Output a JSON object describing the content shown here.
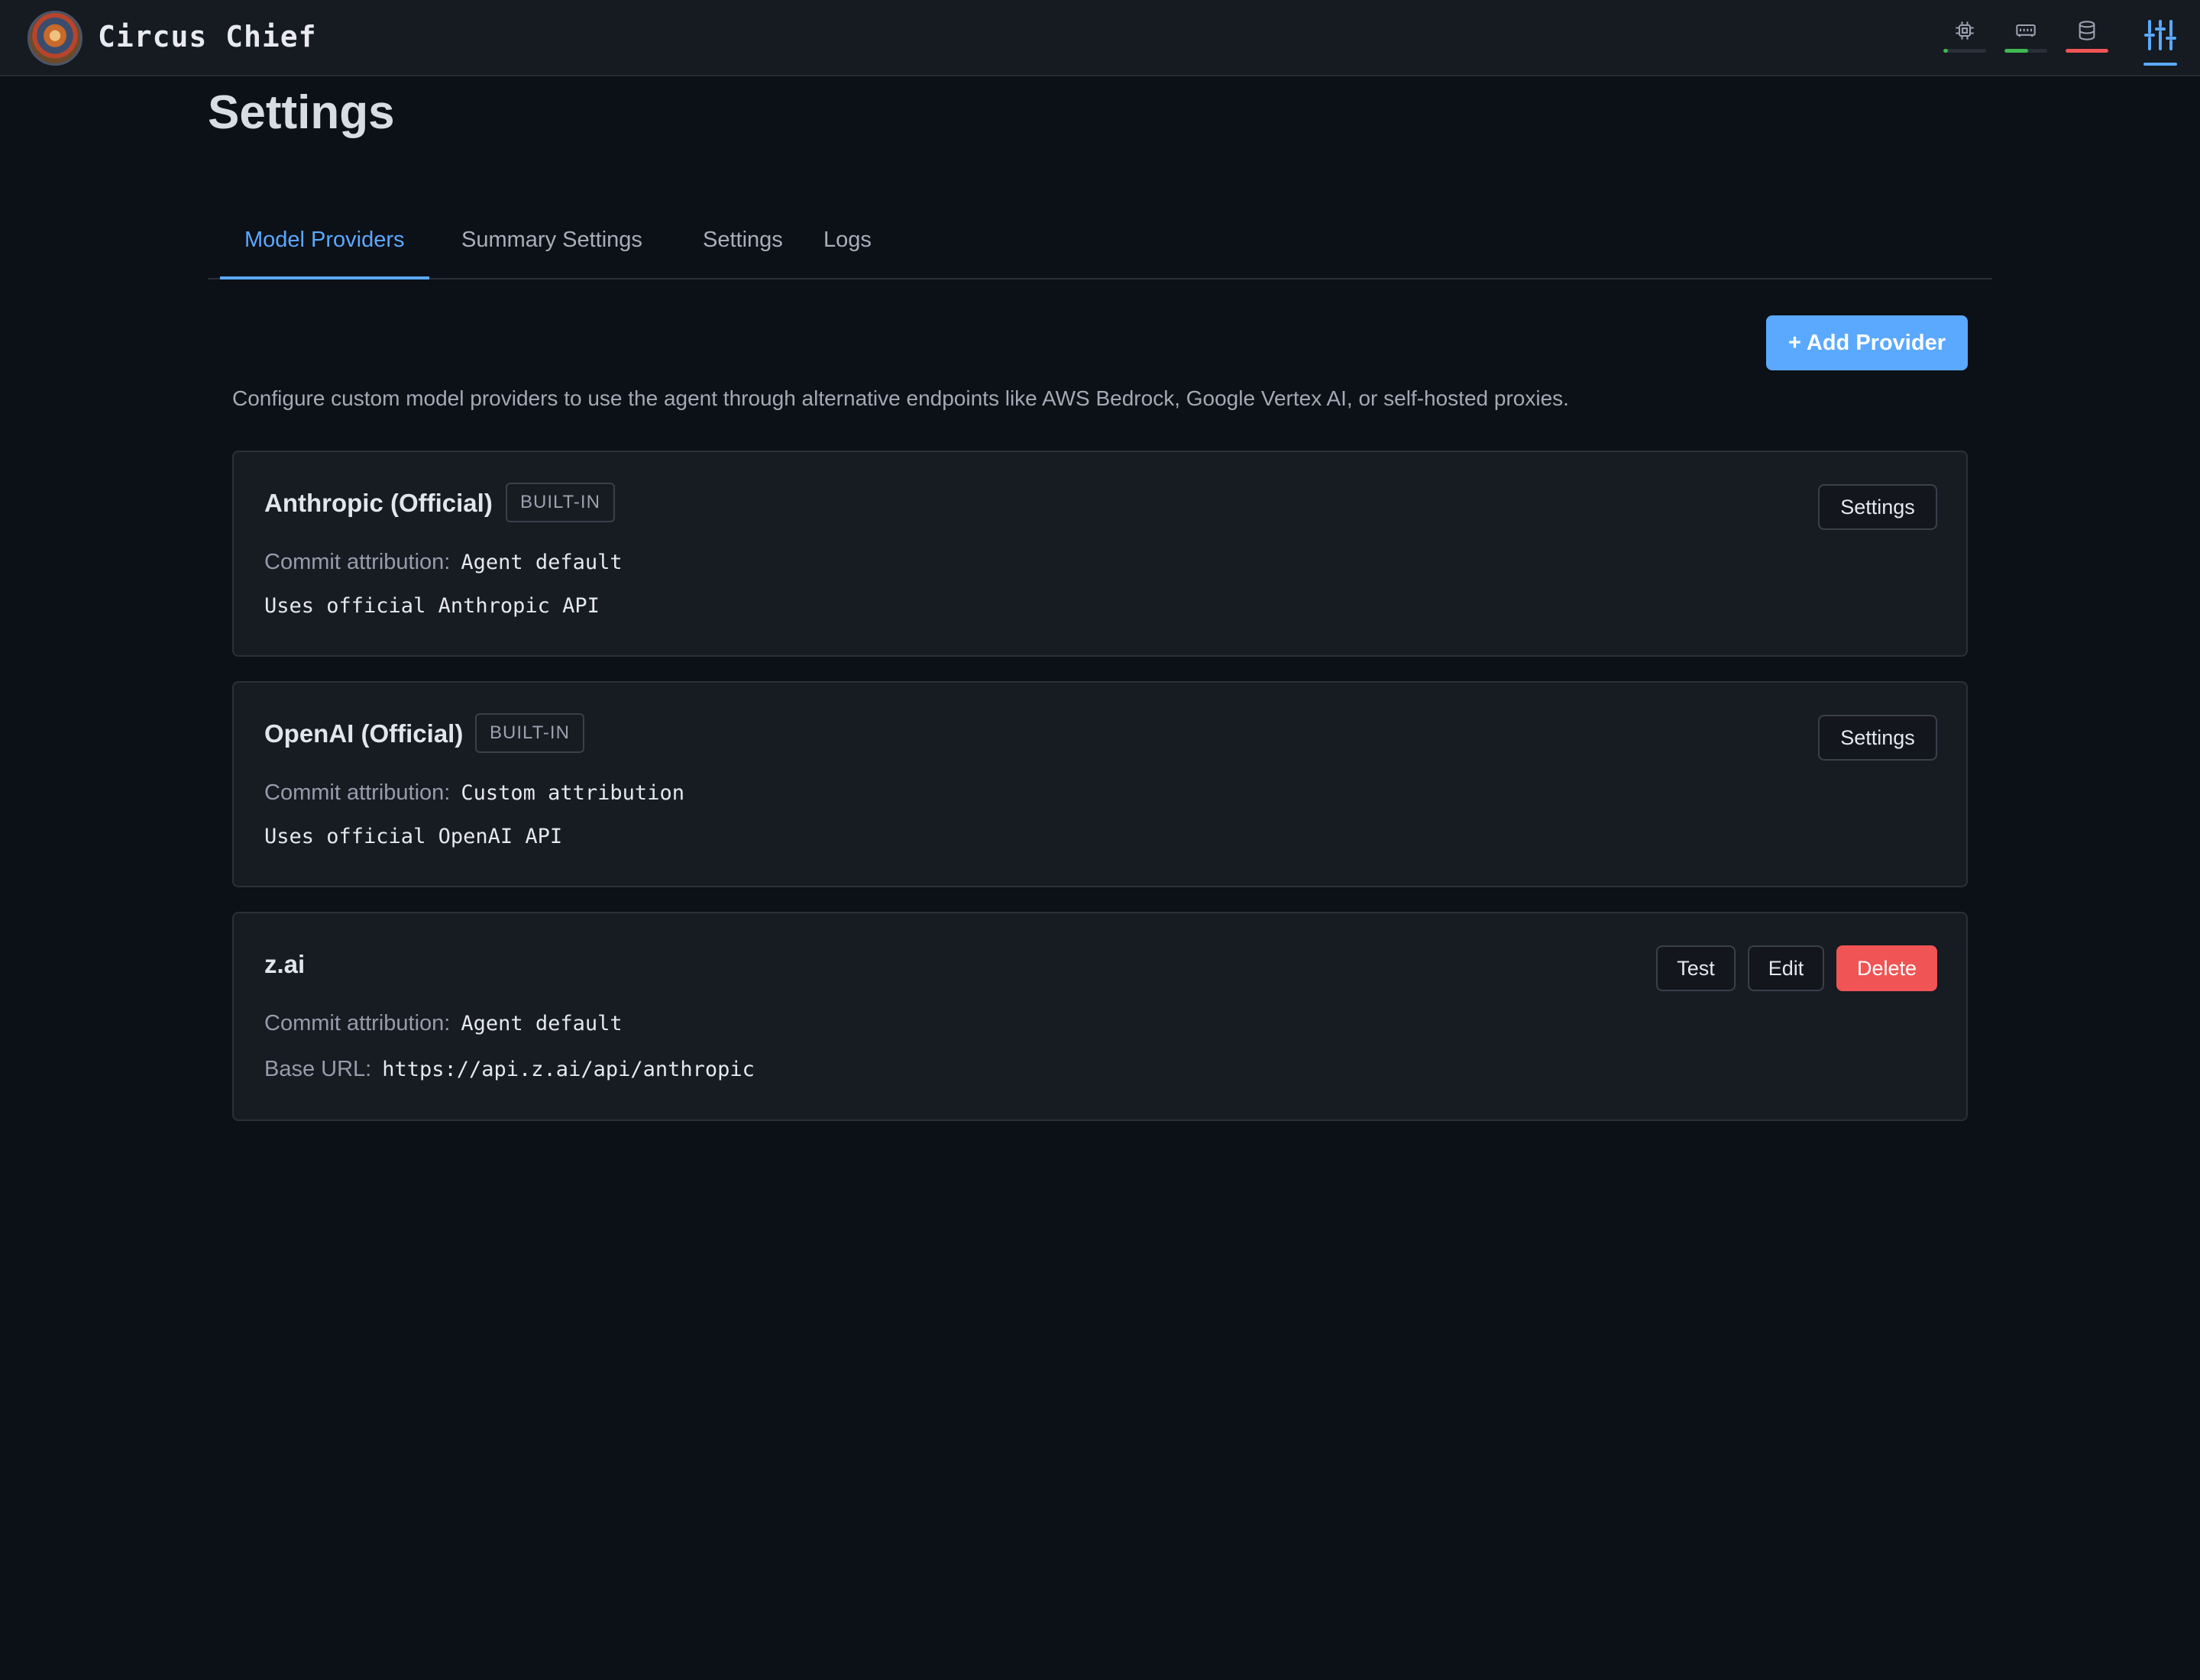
{
  "app": {
    "title": "Circus Chief",
    "status": {
      "cpu": {
        "icon": "cpu-icon",
        "level": 0.1,
        "color": "#3fb950"
      },
      "memory": {
        "icon": "memory-icon",
        "level": 0.55,
        "color": "#3fb950"
      },
      "disk": {
        "icon": "database-icon",
        "level": 1.0,
        "color": "#f05454"
      }
    },
    "settings_icon": "sliders-icon"
  },
  "page": {
    "title": "Settings"
  },
  "tabs": [
    {
      "label": "Model Providers",
      "active": true
    },
    {
      "label": "Summary Settings",
      "active": false
    },
    {
      "label": "Settings",
      "active": false
    },
    {
      "label": "Logs",
      "active": false
    }
  ],
  "providers_panel": {
    "add_button": "+ Add Provider",
    "description": "Configure custom model providers to use the agent through alternative endpoints like AWS Bedrock, Google Vertex AI, or self-hosted proxies.",
    "providers": [
      {
        "name": "Anthropic (Official)",
        "badge": "BUILT-IN",
        "attribution_label": "Commit attribution:",
        "attribution_value": "Agent default",
        "note": "Uses official Anthropic API",
        "settings_button": "Settings"
      },
      {
        "name": "OpenAI (Official)",
        "badge": "BUILT-IN",
        "attribution_label": "Commit attribution:",
        "attribution_value": "Custom attribution",
        "note": "Uses official OpenAI API",
        "settings_button": "Settings"
      },
      {
        "name": "z.ai",
        "attribution_label": "Commit attribution:",
        "attribution_value": "Agent default",
        "base_url_label": "Base URL:",
        "base_url_value": "https://api.z.ai/api/anthropic",
        "test_button": "Test",
        "edit_button": "Edit",
        "delete_button": "Delete"
      }
    ]
  },
  "colors": {
    "accent": "#5aa9ff",
    "danger": "#f05454",
    "success": "#3fb950",
    "background": "#0c1017",
    "card": "#171b22"
  }
}
